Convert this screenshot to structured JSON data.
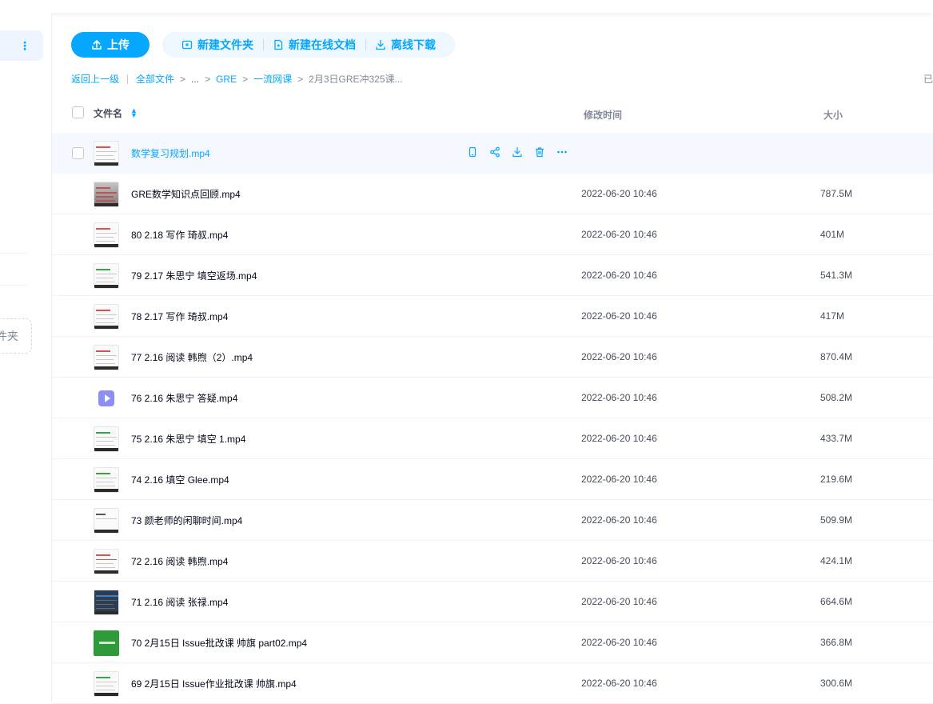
{
  "sidebar": {
    "folder_label": "件夹"
  },
  "toolbar": {
    "upload_label": "上传",
    "new_folder_label": "新建文件夹",
    "new_doc_label": "新建在线文档",
    "offline_download_label": "离线下载"
  },
  "breadcrumb": {
    "back": "返回上一级",
    "all_files": "全部文件",
    "ellipsis": "...",
    "gre": "GRE",
    "course": "一流网课",
    "current": "2月3日GRE冲325课..."
  },
  "right_hint": "已",
  "table": {
    "col_name": "文件名",
    "col_time": "修改时间",
    "col_size": "大小",
    "rows": [
      {
        "name": "数学复习规划.mp4",
        "time": "",
        "size": ""
      },
      {
        "name": "GRE数学知识点回顾.mp4",
        "time": "2022-06-20 10:46",
        "size": "787.5M"
      },
      {
        "name": "80 2.18 写作 琦叔.mp4",
        "time": "2022-06-20 10:46",
        "size": "401M"
      },
      {
        "name": "79 2.17 朱思宁 填空返场.mp4",
        "time": "2022-06-20 10:46",
        "size": "541.3M"
      },
      {
        "name": "78 2.17 写作 琦叔.mp4",
        "time": "2022-06-20 10:46",
        "size": "417M"
      },
      {
        "name": "77 2.16 阅读 韩煦（2）.mp4",
        "time": "2022-06-20 10:46",
        "size": "870.4M"
      },
      {
        "name": "76 2.16 朱思宁 答疑.mp4",
        "time": "2022-06-20 10:46",
        "size": "508.2M"
      },
      {
        "name": "75 2.16 朱思宁 填空 1.mp4",
        "time": "2022-06-20 10:46",
        "size": "433.7M"
      },
      {
        "name": "74 2.16 填空 Glee.mp4",
        "time": "2022-06-20 10:46",
        "size": "219.6M"
      },
      {
        "name": "73 颜老师的闲聊时间.mp4",
        "time": "2022-06-20 10:46",
        "size": "509.9M"
      },
      {
        "name": "72 2.16 阅读 韩煦.mp4",
        "time": "2022-06-20 10:46",
        "size": "424.1M"
      },
      {
        "name": "71 2.16 阅读 张禄.mp4",
        "time": "2022-06-20 10:46",
        "size": "664.6M"
      },
      {
        "name": "70 2月15日 Issue批改课 帅旗 part02.mp4",
        "time": "2022-06-20 10:46",
        "size": "366.8M"
      },
      {
        "name": "69 2月15日 Issue作业批改课 帅旗.mp4",
        "time": "2022-06-20 10:46",
        "size": "300.6M"
      }
    ]
  },
  "colors": {
    "accent": "#06a7ff",
    "hover_row": "#f5f8ff",
    "text": "#03081a",
    "muted": "#818999"
  }
}
